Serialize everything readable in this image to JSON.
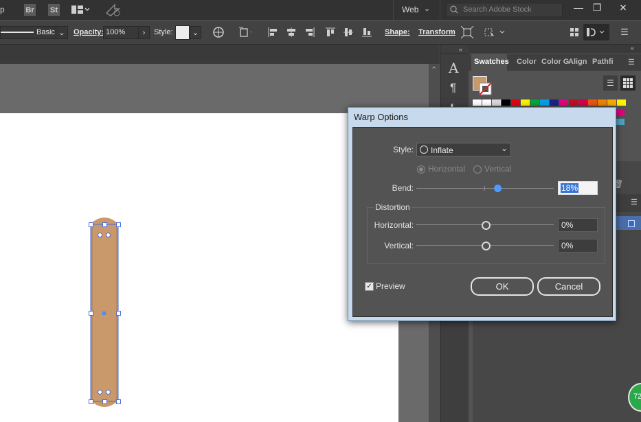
{
  "menubar": {
    "left_fragment": "p",
    "bridge": "Br",
    "stock": "St",
    "workspace": "Web",
    "search_placeholder": "Search Adobe Stock"
  },
  "control": {
    "stroke_profile": "Basic",
    "opacity_label": "Opacity:",
    "opacity_value": "100%",
    "style_label": "Style:",
    "shape_label": "Shape:",
    "transform_label": "Transform"
  },
  "panels": {
    "tabs": [
      "Swatches",
      "Color",
      "Color G",
      "Align",
      "Pathfi"
    ],
    "badge": "72"
  },
  "dialog": {
    "title": "Warp Options",
    "style_label": "Style:",
    "style_value": "Inflate",
    "orientation_horizontal": "Horizontal",
    "orientation_vertical": "Vertical",
    "bend_label": "Bend:",
    "bend_value": "18%",
    "bend_fraction": 0.59,
    "distortion_label": "Distortion",
    "horizontal_label": "Horizontal:",
    "horizontal_value": "0%",
    "vertical_label": "Vertical:",
    "vertical_value": "0%",
    "preview_label": "Preview",
    "preview_checked": true,
    "ok_label": "OK",
    "cancel_label": "Cancel"
  },
  "colors": {
    "object_fill": "#c9986b",
    "selection": "#4a6bdc",
    "bend_knob": "#4d9bff"
  }
}
